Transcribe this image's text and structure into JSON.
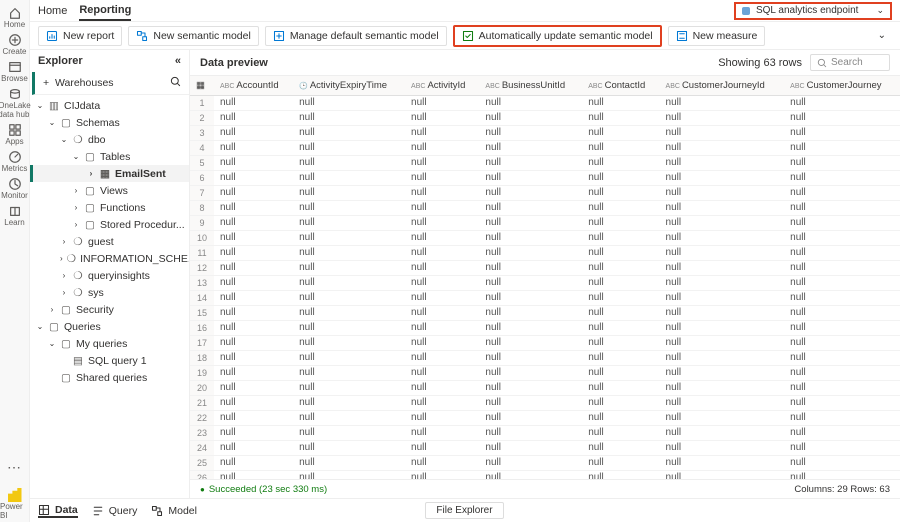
{
  "leftnav": [
    {
      "name": "home",
      "label": "Home"
    },
    {
      "name": "create",
      "label": "Create"
    },
    {
      "name": "browse",
      "label": "Browse"
    },
    {
      "name": "onelake",
      "label": "OneLake data hub"
    },
    {
      "name": "apps",
      "label": "Apps"
    },
    {
      "name": "metrics",
      "label": "Metrics"
    },
    {
      "name": "monitor",
      "label": "Monitor"
    },
    {
      "name": "learn",
      "label": "Learn"
    }
  ],
  "bottomnav": {
    "powerbi": "Power BI"
  },
  "pageTabs": {
    "home": "Home",
    "reporting": "Reporting"
  },
  "endpoint": {
    "label": "SQL analytics endpoint"
  },
  "toolbar": {
    "newReport": "New report",
    "newSemanticModel": "New semantic model",
    "manageDefault": "Manage default semantic model",
    "autoUpdate": "Automatically update semantic model",
    "newMeasure": "New measure"
  },
  "explorer": {
    "title": "Explorer",
    "add": "+",
    "warehouses": "Warehouses",
    "tree": [
      {
        "d": 0,
        "e": "v",
        "i": "db",
        "t": "CIJdata"
      },
      {
        "d": 1,
        "e": "v",
        "i": "fd",
        "t": "Schemas"
      },
      {
        "d": 2,
        "e": "v",
        "i": "sc",
        "t": "dbo"
      },
      {
        "d": 3,
        "e": "v",
        "i": "fd",
        "t": "Tables"
      },
      {
        "d": 4,
        "e": ">",
        "i": "tb",
        "t": "EmailSent",
        "active": true
      },
      {
        "d": 3,
        "e": ">",
        "i": "fd",
        "t": "Views"
      },
      {
        "d": 3,
        "e": ">",
        "i": "fd",
        "t": "Functions"
      },
      {
        "d": 3,
        "e": ">",
        "i": "fd",
        "t": "Stored Procedur..."
      },
      {
        "d": 2,
        "e": ">",
        "i": "sc",
        "t": "guest"
      },
      {
        "d": 2,
        "e": ">",
        "i": "sc",
        "t": "INFORMATION_SCHE..."
      },
      {
        "d": 2,
        "e": ">",
        "i": "sc",
        "t": "queryinsights"
      },
      {
        "d": 2,
        "e": ">",
        "i": "sc",
        "t": "sys"
      },
      {
        "d": 1,
        "e": ">",
        "i": "fd",
        "t": "Security"
      },
      {
        "d": 0,
        "e": "v",
        "i": "fd",
        "t": "Queries"
      },
      {
        "d": 1,
        "e": "v",
        "i": "fd",
        "t": "My queries"
      },
      {
        "d": 2,
        "e": "",
        "i": "sq",
        "t": "SQL query 1"
      },
      {
        "d": 1,
        "e": "",
        "i": "fd",
        "t": "Shared queries"
      }
    ]
  },
  "preview": {
    "title": "Data preview",
    "showing": "Showing 63 rows",
    "searchPlaceholder": "Search",
    "columns": [
      {
        "type": "ABC",
        "name": "AccountId"
      },
      {
        "type": "clk",
        "name": "ActivityExpiryTime"
      },
      {
        "type": "ABC",
        "name": "ActivityId"
      },
      {
        "type": "ABC",
        "name": "BusinessUnitId"
      },
      {
        "type": "ABC",
        "name": "ContactId"
      },
      {
        "type": "ABC",
        "name": "CustomerJourneyId"
      },
      {
        "type": "ABC",
        "name": "CustomerJourney"
      }
    ],
    "rows": 28,
    "nullText": "null"
  },
  "footer": {
    "status": "Succeeded (23 sec 330 ms)",
    "info": "Columns: 29 Rows: 63"
  },
  "bottomTabs": {
    "data": "Data",
    "query": "Query",
    "model": "Model",
    "fileExplorer": "File Explorer"
  }
}
